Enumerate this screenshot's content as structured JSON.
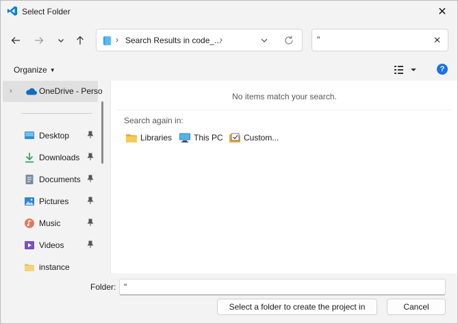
{
  "window": {
    "title": "Select Folder",
    "close_glyph": "✕"
  },
  "nav": {
    "back_icon": "arrow-left-icon",
    "forward_icon": "arrow-right-icon",
    "recent_icon": "chevron-down-icon",
    "up_icon": "arrow-up-icon"
  },
  "address": {
    "separator": "›",
    "path_text": "Search Results in code_...",
    "dropdown_glyph": "⌄",
    "refresh_glyph": "↻"
  },
  "search": {
    "value": "\"",
    "clear_glyph": "✕"
  },
  "command_bar": {
    "organize_label": "Organize",
    "organize_caret": "▼",
    "help_glyph": "?"
  },
  "nav_pane": {
    "onedrive_label": "OneDrive - Perso",
    "expand_glyph": "›",
    "items": [
      {
        "label": "Desktop",
        "icon": "desktop-icon",
        "pinned": true
      },
      {
        "label": "Downloads",
        "icon": "downloads-icon",
        "pinned": true
      },
      {
        "label": "Documents",
        "icon": "documents-icon",
        "pinned": true
      },
      {
        "label": "Pictures",
        "icon": "pictures-icon",
        "pinned": true
      },
      {
        "label": "Music",
        "icon": "music-icon",
        "pinned": true
      },
      {
        "label": "Videos",
        "icon": "videos-icon",
        "pinned": true
      },
      {
        "label": "instance",
        "icon": "folder-icon",
        "pinned": false
      }
    ]
  },
  "content": {
    "empty_message": "No items match your search.",
    "search_again_label": "Search again in:",
    "search_again_links": [
      {
        "label": "Libraries",
        "icon": "libraries-folder-icon"
      },
      {
        "label": "This PC",
        "icon": "this-pc-icon"
      },
      {
        "label": "Custom...",
        "icon": "custom-search-icon"
      }
    ]
  },
  "footer": {
    "folder_label": "Folder:",
    "folder_value": "\"",
    "primary_button": "Select a folder to create the project in",
    "cancel_button": "Cancel"
  },
  "colors": {
    "accent": "#1a73e8",
    "vscode_blue": "#0a7bd6",
    "folder_yellow": "#f2c14e",
    "window_bg": "#f3f3f3",
    "content_bg": "#ffffff"
  }
}
